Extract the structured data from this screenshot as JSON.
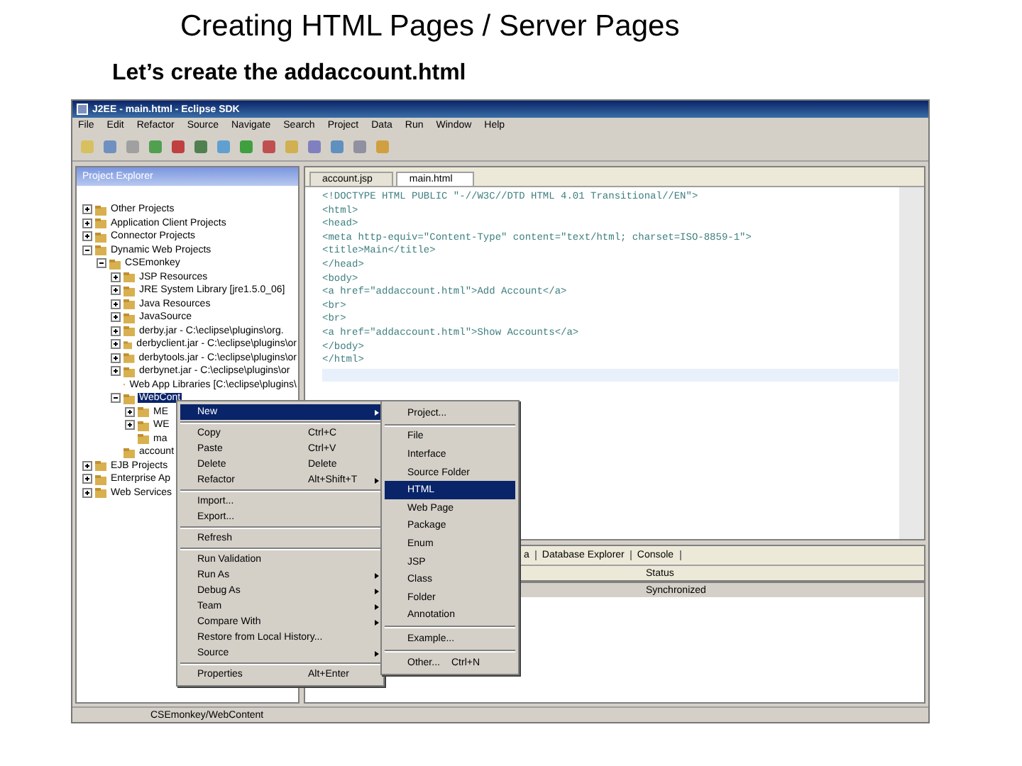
{
  "slide": {
    "title": "Creating HTML Pages / Server Pages",
    "subtitle": "Let’s create the addaccount.html"
  },
  "window": {
    "title": "J2EE - main.html - Eclipse SDK"
  },
  "menu_bar": [
    "File",
    "Edit",
    "Refactor",
    "Source",
    "Navigate",
    "Search",
    "Project",
    "Data",
    "Run",
    "Window",
    "Help"
  ],
  "project_explorer": {
    "title": "Project Explorer",
    "tree": [
      {
        "label": "Other Projects",
        "expanded": false,
        "selected": false
      },
      {
        "label": "Application Client Projects",
        "expanded": false,
        "selected": false
      },
      {
        "label": "Connector Projects",
        "expanded": false,
        "selected": false
      },
      {
        "label": "Dynamic Web Projects",
        "expanded": true,
        "selected": false,
        "children": [
          {
            "label": "CSEmonkey",
            "expanded": true,
            "selected": false,
            "children": [
              {
                "label": "JSP Resources",
                "expanded": false,
                "selected": false
              },
              {
                "label": "JRE System Library [jre1.5.0_06]",
                "expanded": false,
                "selected": false
              },
              {
                "label": "Java Resources",
                "expanded": false,
                "selected": false
              },
              {
                "label": "JavaSource",
                "expanded": false,
                "selected": false
              },
              {
                "label": "derby.jar - C:\\eclipse\\plugins\\org.",
                "expanded": false,
                "selected": false
              },
              {
                "label": "derbyclient.jar - C:\\eclipse\\plugins\\or",
                "expanded": false,
                "selected": false
              },
              {
                "label": "derbytools.jar - C:\\eclipse\\plugins\\or",
                "expanded": false,
                "selected": false
              },
              {
                "label": "derbynet.jar - C:\\eclipse\\plugins\\or",
                "expanded": false,
                "selected": false
              },
              {
                "label": "Web App Libraries [C:\\eclipse\\plugins\\",
                "selected": false
              },
              {
                "label": "WebCont",
                "expanded": true,
                "selected": true,
                "children": [
                  {
                    "label": "ME",
                    "expanded": false,
                    "selected": false
                  },
                  {
                    "label": "WE",
                    "expanded": false,
                    "selected": false
                  },
                  {
                    "label": "ma",
                    "selected": false
                  }
                ]
              },
              {
                "label": "account",
                "selected": false
              }
            ]
          }
        ]
      },
      {
        "label": "EJB Projects",
        "expanded": false,
        "selected": false
      },
      {
        "label": "Enterprise Ap",
        "expanded": false,
        "selected": false
      },
      {
        "label": "Web Services",
        "expanded": false,
        "selected": false
      }
    ]
  },
  "editor": {
    "tabs": [
      {
        "label": "account.jsp",
        "selected": false
      },
      {
        "label": "main.html",
        "selected": true
      }
    ],
    "lines": [
      "<!DOCTYPE HTML PUBLIC \"-//W3C//DTD HTML 4.01 Transitional//EN\">",
      "<html>",
      "<head>",
      "<meta http-equiv=\"Content-Type\" content=\"text/html; charset=ISO-8859-1\">",
      "<title>Main</title>",
      "</head>",
      "<body>",
      "<a href=\"addaccount.html\">Add Account</a>",
      "<br>",
      "<br>",
      "<a href=\"addaccount.html\">Show Accounts</a>",
      "</body>",
      "</html>"
    ]
  },
  "bottom_panel": {
    "tabs": [
      "a",
      "Database Explorer",
      "Console"
    ],
    "column": "Status",
    "row": "Synchronized"
  },
  "status_bar": "CSEmonkey/WebContent",
  "context_menu": {
    "groups": [
      [
        {
          "label": "New",
          "has_submenu": true,
          "selected": true
        }
      ],
      [
        {
          "label": "Copy",
          "shortcut": "Ctrl+C",
          "has_submenu": false,
          "selected": false
        },
        {
          "label": "Paste",
          "shortcut": "Ctrl+V",
          "has_submenu": false,
          "selected": false
        },
        {
          "label": "Delete",
          "shortcut": "Delete",
          "has_submenu": false,
          "selected": false
        },
        {
          "label": "Refactor",
          "shortcut": "Alt+Shift+T",
          "has_submenu": true,
          "selected": false
        }
      ],
      [
        {
          "label": "Import...",
          "has_submenu": false,
          "selected": false
        },
        {
          "label": "Export...",
          "has_submenu": false,
          "selected": false
        }
      ],
      [
        {
          "label": "Refresh",
          "has_submenu": false,
          "selected": false
        }
      ],
      [
        {
          "label": "Run Validation",
          "has_submenu": false,
          "selected": false
        },
        {
          "label": "Run As",
          "has_submenu": true,
          "selected": false
        },
        {
          "label": "Debug As",
          "has_submenu": true,
          "selected": false
        },
        {
          "label": "Team",
          "has_submenu": true,
          "selected": false
        },
        {
          "label": "Compare With",
          "has_submenu": true,
          "selected": false
        },
        {
          "label": "Restore from Local History...",
          "has_submenu": false,
          "selected": false
        },
        {
          "label": "Source",
          "has_submenu": true,
          "selected": false
        }
      ],
      [
        {
          "label": "Properties",
          "shortcut": "Alt+Enter",
          "has_submenu": false,
          "selected": false
        }
      ]
    ]
  },
  "submenu": {
    "groups": [
      [
        {
          "label": "Project...",
          "selected": false
        }
      ],
      [
        {
          "label": "File",
          "selected": false
        },
        {
          "label": "Interface",
          "selected": false
        },
        {
          "label": "Source Folder",
          "selected": false
        },
        {
          "label": "HTML",
          "selected": true
        },
        {
          "label": "Web Page",
          "selected": false
        },
        {
          "label": "Package",
          "selected": false
        },
        {
          "label": "Enum",
          "selected": false
        },
        {
          "label": "JSP",
          "selected": false
        },
        {
          "label": "Class",
          "selected": false
        },
        {
          "label": "Folder",
          "selected": false
        },
        {
          "label": "Annotation",
          "selected": false
        }
      ],
      [
        {
          "label": "Example...",
          "selected": false
        }
      ],
      [
        {
          "label": "Other...",
          "shortcut": "Ctrl+N",
          "selected": false
        }
      ]
    ]
  }
}
